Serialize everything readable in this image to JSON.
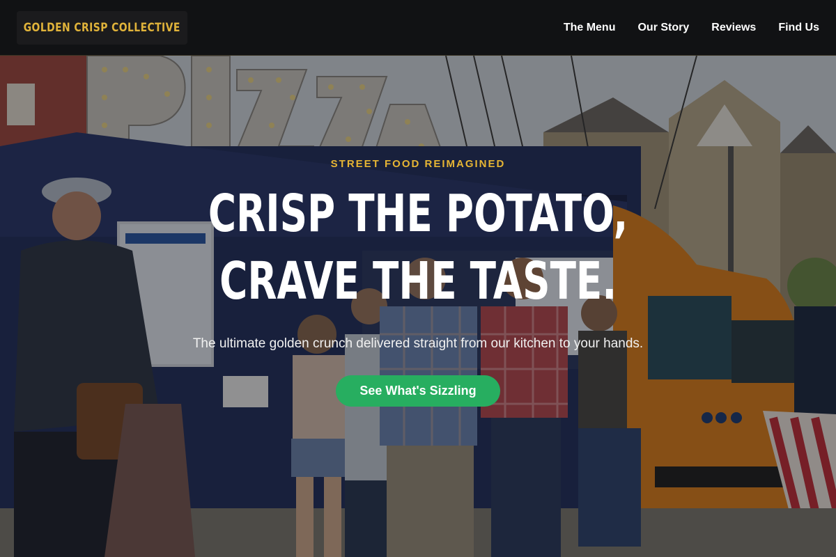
{
  "header": {
    "logo": "GOLDEN CRISP COLLECTIVE",
    "nav": [
      {
        "label": "The Menu"
      },
      {
        "label": "Our Story"
      },
      {
        "label": "Reviews"
      },
      {
        "label": "Find Us"
      }
    ]
  },
  "hero": {
    "eyebrow": "STREET FOOD REIMAGINED",
    "headline_line1": "CRISP THE POTATO,",
    "headline_line2": "CRAVE THE TASTE.",
    "subtitle": "The ultimate golden crunch delivered straight from our kitchen to your hands.",
    "cta_label": "See What's Sizzling",
    "background_sign": "PIZZA"
  },
  "colors": {
    "accent": "#e6b534",
    "cta": "#27ae60",
    "header_bg": "#111214",
    "van_orange": "#e0821e",
    "truck_blue": "#232d55"
  }
}
